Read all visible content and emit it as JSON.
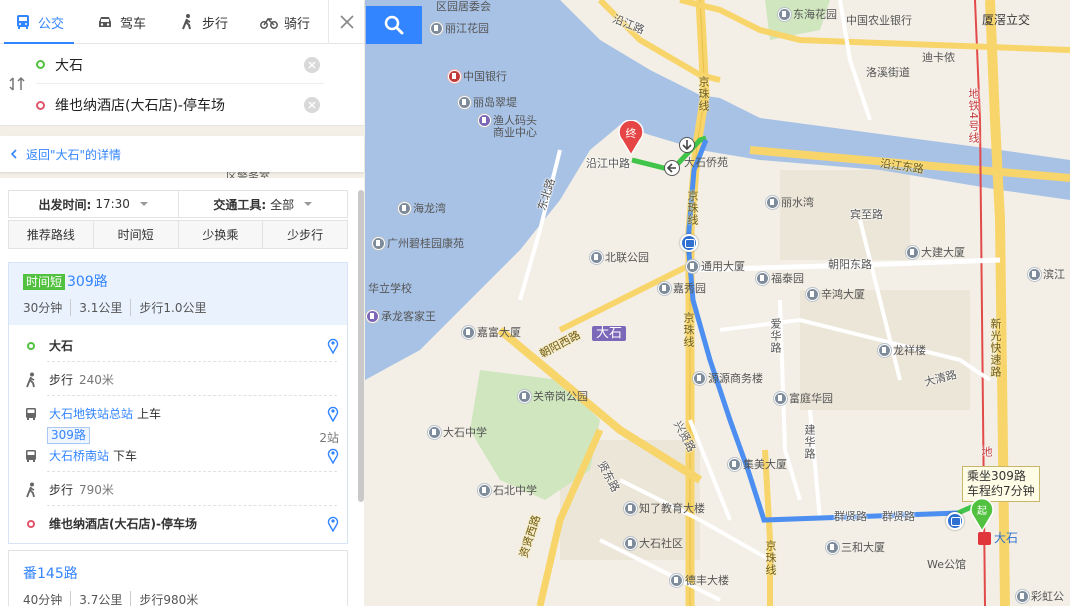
{
  "modes": [
    {
      "label": "公交",
      "icon": "bus-icon",
      "active": true
    },
    {
      "label": "驾车",
      "icon": "car-icon",
      "active": false
    },
    {
      "label": "步行",
      "icon": "walk-icon",
      "active": false
    },
    {
      "label": "骑行",
      "icon": "bike-icon",
      "active": false
    }
  ],
  "route_input": {
    "origin": "大石",
    "destination": "维也纳酒店(大石店)-停车场"
  },
  "back_link": "返回\"大石\"的详情",
  "filters": {
    "depart_label": "出发时间:",
    "depart_value": "17:30",
    "vehicle_label": "交通工具:",
    "vehicle_value": "全部"
  },
  "sort_tabs": [
    "推荐路线",
    "时间短",
    "少换乘",
    "少步行"
  ],
  "routes": [
    {
      "tag": "时间短",
      "name": "309路",
      "duration": "30分钟",
      "distance": "3.1公里",
      "walk": "步行1.0公里",
      "steps": {
        "start": "大石",
        "walk1_label": "步行",
        "walk1_dist": "240米",
        "board_stop": "大石地铁站总站",
        "board_action": "上车",
        "line_chip": "309路",
        "stop_count": "2站",
        "alight_stop": "大石桥南站",
        "alight_action": "下车",
        "walk2_label": "步行",
        "walk2_dist": "790米",
        "end": "维也纳酒店(大石店)-停车场"
      }
    },
    {
      "tag": "",
      "name": "番145路",
      "duration": "40分钟",
      "distance": "3.7公里",
      "walk": "步行980米"
    }
  ],
  "map": {
    "tooltip_line1": "乘坐309路",
    "tooltip_line2": "车程约7分钟",
    "end_pin": "终",
    "start_pin": "起",
    "start_stop_label": "大石",
    "district": "大石",
    "labels": {
      "l_lijiang": "丽江花园",
      "l_boc": "中国银行",
      "l_lidao": "丽岛翠堤",
      "l_yuren": "渔人码头",
      "l_yuren2": "商业中心",
      "l_police": "区警务室",
      "l_hailong": "海龙湾",
      "l_biguiyuan": "广州碧桂园康苑",
      "l_huali": "华立学校",
      "l_chenglong": "承龙客家王",
      "l_jiafu": "嘉富大厦",
      "l_guanbei": "关帝岗公园",
      "l_dashizx": "大石中学",
      "l_shibei": "石北中学",
      "l_zhiliao": "知了教育大楼",
      "l_dashisq": "大石社区",
      "l_defeng": "德丰大楼",
      "l_beilian": "北联公园",
      "l_tongyong": "通用大厦",
      "l_fengtai": "福泰园",
      "l_jixiu": "嘉秀园",
      "l_yuanyuan": "源源商务楼",
      "l_jimei": "集美大厦",
      "l_fuyuan": "富庭华园",
      "l_longxiang": "龙祥楼",
      "l_xinhong": "辛鸿大厦",
      "l_lishui": "丽水湾",
      "l_dajian": "大建大厦",
      "l_binjiang": "滨江",
      "l_sanhe": "三和大厦",
      "l_wegongyu": "We公馆",
      "l_caihong": "彩虹公",
      "l_donghai": "东海花园",
      "l_nongye": "中国农业银行",
      "l_dikayi": "迪卡侬",
      "l_xiajiao": "厦滘立交",
      "l_luojiao": "洛溪街道",
      "l_dashiqiao": "大石侨苑",
      "l_qiaobei": "区园居委会"
    },
    "streets": {
      "s_yanjiang_w": "沿江路",
      "s_yanjiang_zhong": "沿江中路",
      "s_yanjiang_east": "沿江东路",
      "s_jingzhu1": "京珠线",
      "s_jingzhu2": "京珠线",
      "s_jingzhu3": "京珠线",
      "s_jingzhu4": "京珠线",
      "s_qunxian1": "群贤路",
      "s_qunxian2": "群贤路",
      "s_binbao": "宾至路",
      "s_chaoyang_e": "朝阳东路",
      "s_chaoyang_w": "朝阳西路",
      "s_aihua": "爱华路",
      "s_jianhua": "建华路",
      "s_daqing": "大清路",
      "s_xingxian": "兴贤路",
      "s_zixian": "资贤西路",
      "s_guangxian": "贤东路",
      "s_dongbei": "东北路",
      "s_metro4": "地铁4号线",
      "s_xinguang": "新光快速路",
      "s_metro": "地",
      "s_quhuan": "群贤路"
    }
  }
}
